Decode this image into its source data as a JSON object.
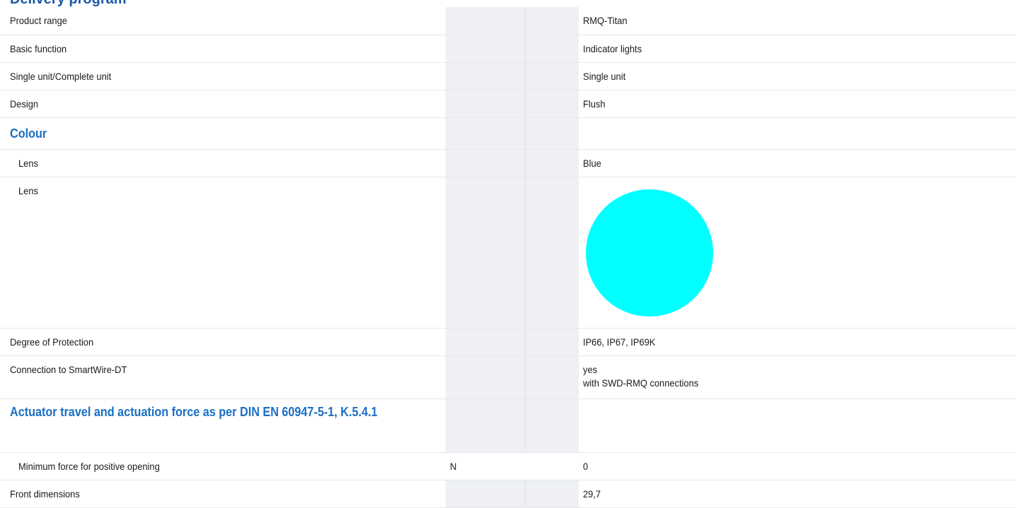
{
  "header": {
    "title": "Delivery program"
  },
  "rows": [
    {
      "label": "Product range",
      "unit": "",
      "value": "RMQ-Titan"
    },
    {
      "label": "Basic function",
      "unit": "",
      "value": "Indicator lights"
    },
    {
      "label": "Single unit/Complete unit",
      "unit": "",
      "value": "Single unit"
    },
    {
      "label": "Design",
      "unit": "",
      "value": "Flush"
    },
    {
      "section": "Colour"
    },
    {
      "label": "Lens",
      "unit": "",
      "value": "Blue"
    },
    {
      "label": "Lens",
      "unit": "",
      "swatch_color": "#00ffff"
    },
    {
      "label": "Degree of Protection",
      "unit": "",
      "value": "IP66, IP67, IP69K"
    },
    {
      "label": "Connection to SmartWire-DT",
      "unit": "",
      "value": "yes",
      "value2": "with SWD-RMQ connections"
    },
    {
      "section": "Actuator travel and actuation force as per DIN EN 60947-5-1, K.5.4.1"
    },
    {
      "label": "Minimum force for positive opening",
      "unit": "N",
      "value": "0"
    },
    {
      "label": "Front dimensions",
      "unit": "",
      "value": "29,7"
    }
  ]
}
